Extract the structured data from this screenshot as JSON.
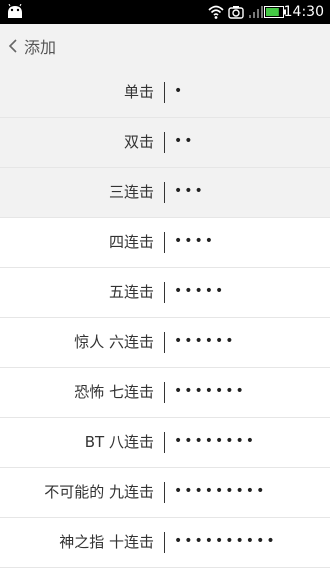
{
  "status_bar": {
    "time": "14:30",
    "battery_level": 0.8,
    "icons": [
      "android-icon",
      "wifi-icon",
      "camera-icon",
      "signal-icon",
      "battery-icon"
    ]
  },
  "header": {
    "back_label": "添加",
    "back_icon": "chevron-left-icon"
  },
  "colors": {
    "status_bar_bg": "#000000",
    "header_bg": "#f2f2f2",
    "tinted_row_bg": "#f2f2f2",
    "text": "#333333"
  },
  "rows": [
    {
      "label": "单击",
      "dots": "•"
    },
    {
      "label": "双击",
      "dots": "••"
    },
    {
      "label": "三连击",
      "dots": "•••"
    },
    {
      "label": "四连击",
      "dots": "••••"
    },
    {
      "label": "五连击",
      "dots": "•••••"
    },
    {
      "label": "惊人 六连击",
      "dots": "••••••"
    },
    {
      "label": "恐怖 七连击",
      "dots": "•••••••"
    },
    {
      "label": "BT 八连击",
      "dots": "••••••••"
    },
    {
      "label": "不可能的 九连击",
      "dots": "•••••••••"
    },
    {
      "label": "神之指 十连击",
      "dots": "••••••••••"
    }
  ]
}
